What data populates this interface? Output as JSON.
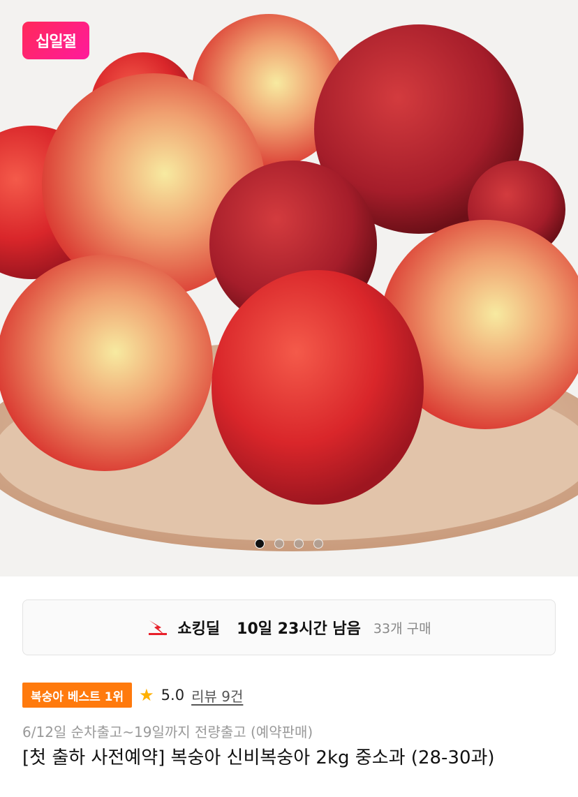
{
  "hero": {
    "badge_label": "십일절",
    "slides_total": 4,
    "slide_active": 1
  },
  "deal": {
    "title": "쇼킹딜",
    "time_left": "10일 23시간 남음",
    "purchase_count": "33개 구매",
    "icon": "bolt-icon"
  },
  "product": {
    "best_badge": "복숭아 베스트 1위",
    "rating_icon": "star-icon",
    "rating": "5.0",
    "reviews": "리뷰 9건",
    "shipping": "6/12일 순차출고~19일까지 전량출고 (예약판매)",
    "title": "[첫 출하 사전예약] 복숭아 신비복숭아 2kg 중소과 (28-30과)"
  },
  "colors": {
    "badge": "#ff2a5a",
    "best_badge": "#ff7a0d",
    "star": "#ffb000",
    "deal_icon": "#e8202a"
  }
}
